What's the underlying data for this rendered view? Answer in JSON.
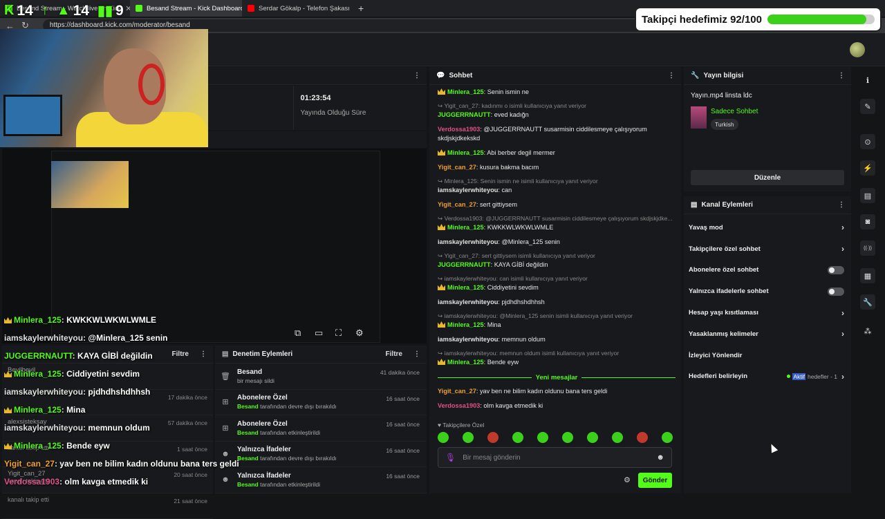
{
  "browser": {
    "tabs": [
      {
        "label": "Besand Stream - Watch live on Kick",
        "favicon_color": "#53fc18"
      },
      {
        "label": "Besand Stream - Kick Dashboard",
        "favicon_color": "#53fc18"
      },
      {
        "label": "Serdar Gökalp - Telefon Şakası | O",
        "favicon_color": "#ff0000"
      }
    ],
    "new_tab": "+",
    "url": "https://dashboard.kick.com/moderator/besand"
  },
  "overlay": {
    "counters": [
      {
        "icon": "kick-logo-icon",
        "value": "14",
        "glyph": "K"
      },
      {
        "icon": "arrow-up-icon",
        "value": "",
        "glyph": "↑"
      },
      {
        "icon": "person-icon",
        "value": "14",
        "glyph": "▲"
      },
      {
        "icon": "bars-icon",
        "value": "9",
        "glyph": "▮▮"
      }
    ],
    "goal": {
      "text": "Takipçi hedefimiz 92/100",
      "progress": 0.92,
      "color": "#3bd11a"
    },
    "chat": [
      {
        "user": "Minlera_125",
        "user_color": "#53fc18",
        "text": "KWKKWLWKWLWMLE",
        "crown": true
      },
      {
        "user": "iamskaylerwhiteyou",
        "user_color": "#e0e0e0",
        "text": "@Minlera_125 senin",
        "crown": false
      },
      {
        "user": "JUGGERRNAUTT",
        "user_color": "#53fc18",
        "text": "KAYA GİBİ değildin",
        "crown": false
      },
      {
        "user": "Minlera_125",
        "user_color": "#53fc18",
        "text": "Ciddiyetini sevdim",
        "crown": true
      },
      {
        "user": "iamskaylerwhiteyou",
        "user_color": "#e0e0e0",
        "text": "pjdhdhshdhhsh",
        "crown": false
      },
      {
        "user": "Minlera_125",
        "user_color": "#53fc18",
        "text": "Mina",
        "crown": true
      },
      {
        "user": "iamskaylerwhiteyou",
        "user_color": "#e0e0e0",
        "text": "memnun oldum",
        "crown": false
      },
      {
        "user": "Minlera_125",
        "user_color": "#53fc18",
        "text": "Bende eyw",
        "crown": true
      },
      {
        "user": "Yigit_can_27",
        "user_color": "#f0a030",
        "text": "yav ben ne bilim kadın oldunu bana ters geldi",
        "crown": false
      },
      {
        "user": "Verdossa1903",
        "user_color": "#e0508a",
        "text": "olm kavga etmedik ki",
        "crown": false
      }
    ]
  },
  "stats": [
    {
      "value": "",
      "label": ""
    },
    {
      "value": "-",
      "label": "Abone Sayısı"
    },
    {
      "value": "01:23:54",
      "label": "Yayında Olduğu Süre"
    }
  ],
  "follow_panel": {
    "filter_label": "Filtre",
    "rows": [
      {
        "name": "Beyilbeyil",
        "sub": "",
        "time": ""
      },
      {
        "name": "",
        "sub": "",
        "time": "17 dakika önce"
      },
      {
        "name": "alexsisteksay",
        "sub": "",
        "time": "57 dakika önce"
      },
      {
        "name": "",
        "sub": "kanalı takip etti",
        "time": "1 saat önce"
      },
      {
        "name": "Yigit_can_27",
        "sub": "kanalı takip etti",
        "time": "20 saat önce"
      },
      {
        "name": "",
        "sub": "kanalı takip etti",
        "time": "21 saat önce"
      }
    ]
  },
  "mod_panel": {
    "title": "Denetim Eylemleri",
    "filter_label": "Filtre",
    "rows": [
      {
        "icon": "trash-icon",
        "glyph": "🗑",
        "title": "Besand",
        "actor": "",
        "sub": "bir mesajı sildi",
        "time": "41 dakika önce"
      },
      {
        "icon": "gift-icon",
        "glyph": "⊞",
        "title": "Abonelere Özel",
        "actor": "Besand",
        "sub": "tarafından devre dışı bırakıldı",
        "time": "16 saat önce"
      },
      {
        "icon": "gift-icon",
        "glyph": "⊞",
        "title": "Abonelere Özel",
        "actor": "Besand",
        "sub": "tarafından etkinleştirildi",
        "time": "16 saat önce"
      },
      {
        "icon": "emote-icon",
        "glyph": "☻",
        "title": "Yalnızca İfadeler",
        "actor": "Besand",
        "sub": "tarafından devre dışı bırakıldı",
        "time": "16 saat önce"
      },
      {
        "icon": "emote-icon",
        "glyph": "☻",
        "title": "Yalnızca İfadeler",
        "actor": "Besand",
        "sub": "tarafından etkinleştirildi",
        "time": "16 saat önce"
      }
    ]
  },
  "chat": {
    "title": "Sohbet",
    "messages": [
      {
        "reply": "",
        "user": "Minlera_125",
        "color": "#53fc18",
        "crown": true,
        "text": "Senin ismin ne"
      },
      {
        "reply": "Yigit_can_27: kadınmı o isimli kullanıcıya yanıt veriyor",
        "user": "JUGGERRNAUTT",
        "color": "#53fc18",
        "crown": false,
        "text": "eved kadığn"
      },
      {
        "reply": "",
        "user": "Verdossa1903",
        "color": "#e0508a",
        "crown": false,
        "text": "@JUGGERRNAUTT susarmisin ciddilesmeye çalışıyorum skdjskjdkekskd"
      },
      {
        "reply": "",
        "user": "Minlera_125",
        "color": "#53fc18",
        "crown": true,
        "text": "Abi berber degil mermer"
      },
      {
        "reply": "",
        "user": "Yigit_can_27",
        "color": "#f0a030",
        "crown": false,
        "text": "kusura bakma bacım"
      },
      {
        "reply": "Minlera_125: Senin ismin ne isimli kullanıcıya yanıt veriyor",
        "user": "iamskaylerwhiteyou",
        "color": "#e0e0e0",
        "crown": false,
        "text": "can"
      },
      {
        "reply": "",
        "user": "Yigit_can_27",
        "color": "#f0a030",
        "crown": false,
        "text": "sert gittiysem"
      },
      {
        "reply": "Verdossa1903: @JUGGERRNAUTT susarmisin ciddilesmeye çalışıyorum skdjskjdke...",
        "user": "Minlera_125",
        "color": "#53fc18",
        "crown": true,
        "text": "KWKKWLWKWLWMLE"
      },
      {
        "reply": "",
        "user": "iamskaylerwhiteyou",
        "color": "#e0e0e0",
        "crown": false,
        "text": "@Minlera_125 senin"
      },
      {
        "reply": "Yigit_can_27: sert gittiysem isimli kullanıcıya yanıt veriyor",
        "user": "JUGGERRNAUTT",
        "color": "#53fc18",
        "crown": false,
        "text": "KAYA GİBİ değildin"
      },
      {
        "reply": "iamskaylerwhiteyou: can isimli kullanıcıya yanıt veriyor",
        "user": "Minlera_125",
        "color": "#53fc18",
        "crown": true,
        "text": "Ciddiyetini sevdim"
      },
      {
        "reply": "",
        "user": "iamskaylerwhiteyou",
        "color": "#e0e0e0",
        "crown": false,
        "text": "pjdhdhshdhhsh"
      },
      {
        "reply": "iamskaylerwhiteyou: @Minlera_125 senin isimli kullanıcıya yanıt veriyor",
        "user": "Minlera_125",
        "color": "#53fc18",
        "crown": true,
        "text": "Mina"
      },
      {
        "reply": "",
        "user": "iamskaylerwhiteyou",
        "color": "#e0e0e0",
        "crown": false,
        "text": "memnun oldum"
      },
      {
        "reply": "iamskaylerwhiteyou: memnun oldum isimli kullanıcıya yanıt veriyor",
        "user": "Minlera_125",
        "color": "#53fc18",
        "crown": true,
        "text": "Bende eyw"
      }
    ],
    "new_messages_label": "Yeni mesajlar",
    "new_messages": [
      {
        "user": "Yigit_can_27",
        "color": "#f0a030",
        "crown": false,
        "text": "yav ben ne bilim kadın oldunu bana ters geldi"
      },
      {
        "user": "Verdossa1903",
        "color": "#e0508a",
        "crown": false,
        "text": "olm kavga etmedik ki"
      }
    ],
    "follower_only_label": "Takipçilere Özel",
    "input_placeholder": "Bir mesaj gönderin",
    "send_label": "Gönder"
  },
  "stream_info": {
    "title": "Yayın bilgisi",
    "stream_title": "Yayın.mp4 linsta ldc",
    "category": "Sadece Sohbet",
    "language": "Turkish",
    "edit_label": "Düzenle"
  },
  "channel_actions": {
    "title": "Kanal Eylemleri",
    "items": [
      {
        "label": "Yavaş mod",
        "control": "chevron"
      },
      {
        "label": "Takipçilere özel sohbet",
        "control": "chevron"
      },
      {
        "label": "Abonelere özel sohbet",
        "control": "toggle"
      },
      {
        "label": "Yalnızca ifadelerle sohbet",
        "control": "toggle"
      },
      {
        "label": "Hesap yaşı kısıtlaması",
        "control": "chevron"
      },
      {
        "label": "Yasaklanmış kelimeler",
        "control": "chevron"
      },
      {
        "label": "İzleyici Yönlendir",
        "control": "none"
      },
      {
        "label": "Hedefleri belirleyin",
        "control": "goal",
        "status": "Aktif",
        "status_rest": "hedefler - 1"
      }
    ]
  },
  "rail": [
    {
      "icon": "info-icon",
      "glyph": "ℹ"
    },
    {
      "icon": "pencil-icon",
      "glyph": "✎"
    },
    {
      "icon": "target-icon",
      "glyph": "⊙"
    },
    {
      "icon": "lightning-icon",
      "glyph": "⚡"
    },
    {
      "icon": "document-icon",
      "glyph": "▤"
    },
    {
      "icon": "chat-bubble-icon",
      "glyph": "◙"
    },
    {
      "icon": "broadcast-icon",
      "glyph": "((·))"
    },
    {
      "icon": "calendar-icon",
      "glyph": "▦"
    },
    {
      "icon": "wrench-icon",
      "glyph": "🔧"
    },
    {
      "icon": "shapes-icon",
      "glyph": "⁂"
    }
  ]
}
